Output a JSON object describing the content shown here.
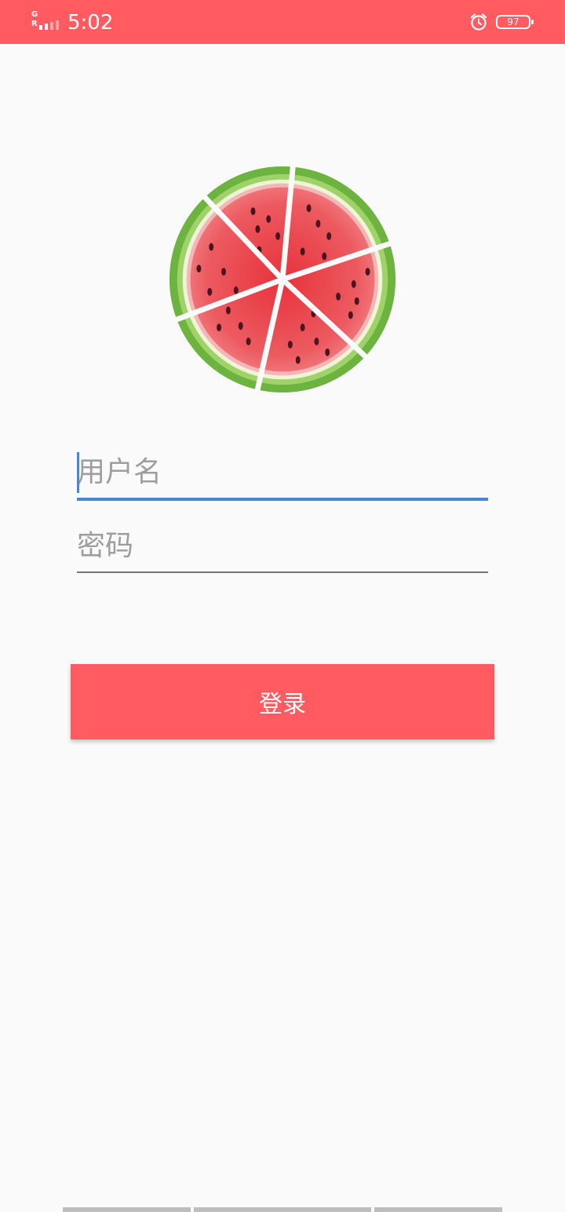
{
  "status_bar": {
    "network_g": "G",
    "network_r": "R",
    "time": "5:02",
    "battery": "97",
    "color": "#ff5b60"
  },
  "login_form": {
    "username_placeholder": "用户名",
    "password_placeholder": "密码",
    "login_label": "登录",
    "accent_color": "#ff5b60",
    "focus_color": "#4a86d1"
  },
  "icons": {
    "logo": "watermelon-icon",
    "alarm": "alarm-clock-icon",
    "battery": "battery-icon",
    "signal": "signal-strength-icon"
  }
}
